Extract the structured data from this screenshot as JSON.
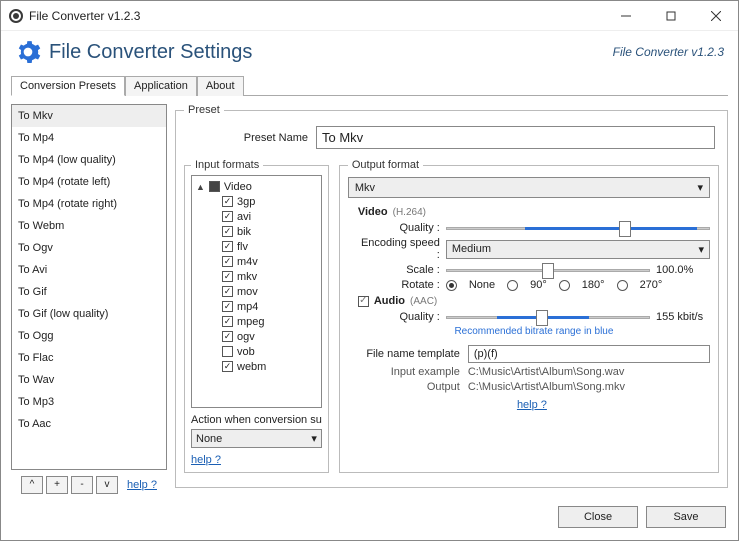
{
  "window": {
    "title": "File Converter v1.2.3"
  },
  "header": {
    "title": "File Converter Settings",
    "version": "File Converter v1.2.3"
  },
  "tabs": [
    "Conversion Presets",
    "Application",
    "About"
  ],
  "presets": [
    "To Mkv",
    "To Mp4",
    "To Mp4 (low quality)",
    "To Mp4 (rotate left)",
    "To Mp4 (rotate right)",
    "To Webm",
    "To Ogv",
    "To Avi",
    "To Gif",
    "To Gif (low quality)",
    "To Ogg",
    "To Flac",
    "To Wav",
    "To Mp3",
    "To Aac"
  ],
  "presetButtons": {
    "up": "^",
    "add": "+",
    "remove": "-",
    "down": "v",
    "help": "help ?"
  },
  "preset": {
    "legend": "Preset",
    "nameLabel": "Preset Name",
    "name": "To Mkv"
  },
  "inputFormats": {
    "legend": "Input formats",
    "group": "Video",
    "items": [
      {
        "label": "3gp",
        "checked": true
      },
      {
        "label": "avi",
        "checked": true
      },
      {
        "label": "bik",
        "checked": true
      },
      {
        "label": "flv",
        "checked": true
      },
      {
        "label": "m4v",
        "checked": true
      },
      {
        "label": "mkv",
        "checked": true
      },
      {
        "label": "mov",
        "checked": true
      },
      {
        "label": "mp4",
        "checked": true
      },
      {
        "label": "mpeg",
        "checked": true
      },
      {
        "label": "ogv",
        "checked": true
      },
      {
        "label": "vob",
        "checked": false
      },
      {
        "label": "webm",
        "checked": true
      }
    ],
    "actionLabel": "Action when conversion su",
    "actionValue": "None",
    "help": "help ?"
  },
  "output": {
    "legend": "Output format",
    "format": "Mkv",
    "video": {
      "title": "Video",
      "codec": "(H.264)",
      "qualityLabel": "Quality :",
      "encodingLabel": "Encoding speed :",
      "encodingValue": "Medium",
      "scaleLabel": "Scale :",
      "scaleValue": "100.0%",
      "rotateLabel": "Rotate :",
      "rotateOptions": [
        "None",
        "90°",
        "180°",
        "270°"
      ],
      "rotateSelected": "None"
    },
    "audio": {
      "title": "Audio",
      "codec": "(AAC)",
      "checked": true,
      "qualityLabel": "Quality :",
      "bitrate": "155 kbit/s",
      "recommended": "Recommended bitrate range in blue"
    },
    "fnt": {
      "label": "File name template",
      "value": "(p)(f)"
    },
    "inputEx": {
      "label": "Input example",
      "value": "C:\\Music\\Artist\\Album\\Song.wav"
    },
    "outputEx": {
      "label": "Output",
      "value": "C:\\Music\\Artist\\Album\\Song.mkv"
    },
    "help": "help ?"
  },
  "footer": {
    "close": "Close",
    "save": "Save"
  }
}
